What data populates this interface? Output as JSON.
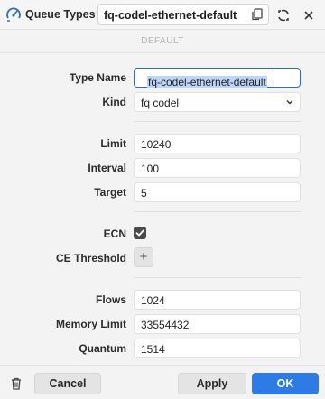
{
  "titlebar": {
    "title": "Queue Types",
    "name": "fq-codel-ethernet-default",
    "icons": [
      "queue-types-icon",
      "copy-icon",
      "restore-icon",
      "close-icon"
    ]
  },
  "section": {
    "label": "DEFAULT"
  },
  "form": {
    "type_name": {
      "label": "Type Name",
      "value": "fq-codel-ethernet-default"
    },
    "kind": {
      "label": "Kind",
      "value": "fq codel"
    },
    "limit": {
      "label": "Limit",
      "value": "10240"
    },
    "interval": {
      "label": "Interval",
      "value": "100"
    },
    "target": {
      "label": "Target",
      "value": "5"
    },
    "ecn": {
      "label": "ECN",
      "checked": true
    },
    "ce_threshold": {
      "label": "CE Threshold",
      "add": "+"
    },
    "flows": {
      "label": "Flows",
      "value": "1024"
    },
    "memory_limit": {
      "label": "Memory Limit",
      "value": "33554432"
    },
    "quantum": {
      "label": "Quantum",
      "value": "1514"
    }
  },
  "footer": {
    "cancel": "Cancel",
    "apply": "Apply",
    "ok": "OK"
  },
  "colors": {
    "accent": "#2d7be5",
    "selection": "#bcd4f5",
    "focus": "#2a6cd2"
  }
}
